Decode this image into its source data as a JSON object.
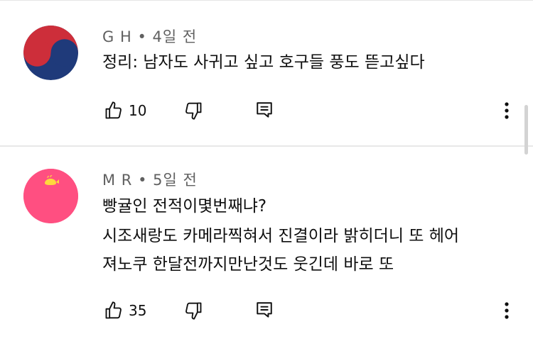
{
  "comments": [
    {
      "author": "G H",
      "separator": "•",
      "time": "4일 전",
      "lines": [
        "정리: 남자도 사귀고 싶고 호구들 풍도 뜯고싶다"
      ],
      "likes": "10",
      "avatar_colors": {
        "top": "#cd2e3a",
        "bottom": "#1f3a7a"
      }
    },
    {
      "author": "M R",
      "separator": "•",
      "time": "5일 전",
      "lines": [
        "빵귤인 전적이몇번째냐?",
        "시조새랑도 카메라찍혀서 진결이라 밝히더니 또 헤어",
        "져노쿠 한달전까지만난것도 웃긴데  바로 또"
      ],
      "likes": "35",
      "avatar_colors": {
        "bg": "#ff4f81",
        "whale": "#ffd83d"
      }
    }
  ],
  "icons": {
    "like": "thumbs-up-icon",
    "dislike": "thumbs-down-icon",
    "reply": "reply-icon",
    "more": "more-vert-icon"
  }
}
